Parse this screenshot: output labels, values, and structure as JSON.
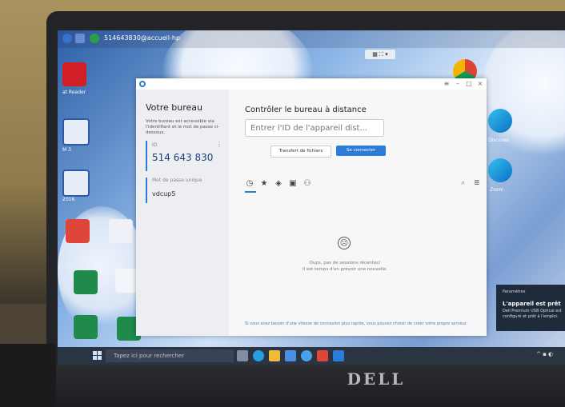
{
  "remote_session": {
    "title": "514643830@accueil-hp"
  },
  "desktop": {
    "icons": [
      {
        "name": "pdf-reader-icon",
        "label": "at Reader"
      },
      {
        "name": "word-doc-icon",
        "label": "M 3"
      },
      {
        "name": "word-doc-2-icon",
        "label": "2016"
      },
      {
        "name": "excel-icon",
        "label": ""
      },
      {
        "name": "edge-icon",
        "label": "Discover"
      },
      {
        "name": "edge-2-icon",
        "label": "Zoom"
      }
    ]
  },
  "app": {
    "sidebar": {
      "title": "Votre bureau",
      "description": "Votre bureau est accessible via l'identifiant et le mot de passe ci-dessous.",
      "id_label": "ID",
      "id_value": "514 643 830",
      "password_label": "Mot de passe unique",
      "password_value": "vdcup5"
    },
    "main": {
      "title": "Contrôler le bureau à distance",
      "id_placeholder": "Entrer l'ID de l'appareil dist...",
      "transfer_button": "Transfert de fichiers",
      "connect_button": "Se connecter",
      "empty_line1": "Oups, pas de sessions récentes!",
      "empty_line2": "Il est temps d'en prévoir une nouvelle.",
      "footer_tip": "Si vous avez besoin d'une vitesse de connexion plus rapide, vous pouvez choisir de créer votre propre serveur."
    }
  },
  "notification": {
    "header": "Paramètres",
    "title": "L'appareil est prêt",
    "body": "Dell Premium USB Optical est configuré et prêt à l'emploi."
  },
  "taskbar": {
    "search_placeholder": "Tapez ici pour rechercher"
  },
  "hardware": {
    "brand": "DELL"
  },
  "colors": {
    "accent": "#2a7cd8",
    "taskbar": "#2b3442"
  }
}
